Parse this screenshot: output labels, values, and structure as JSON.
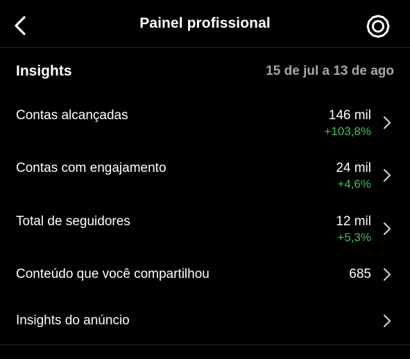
{
  "header": {
    "title": "Painel profissional",
    "back_icon": "chevron-left-icon",
    "settings_icon": "gear-icon"
  },
  "insights": {
    "title": "Insights",
    "date_range": "15 de jul a 13 de ago"
  },
  "rows": [
    {
      "label": "Contas alcançadas",
      "value": "146 mil",
      "change": "+103,8%"
    },
    {
      "label": "Contas com engajamento",
      "value": "24 mil",
      "change": "+4,6%"
    },
    {
      "label": "Total de seguidores",
      "value": "12 mil",
      "change": "+5,3%"
    },
    {
      "label": "Conteúdo que você compartilhou",
      "value": "685"
    },
    {
      "label": "Insights do anúncio"
    }
  ],
  "colors": {
    "background": "#000000",
    "text": "#ffffff",
    "secondary_text": "#a8a8a8",
    "positive_change": "#3ec25f",
    "divider": "#262626"
  }
}
